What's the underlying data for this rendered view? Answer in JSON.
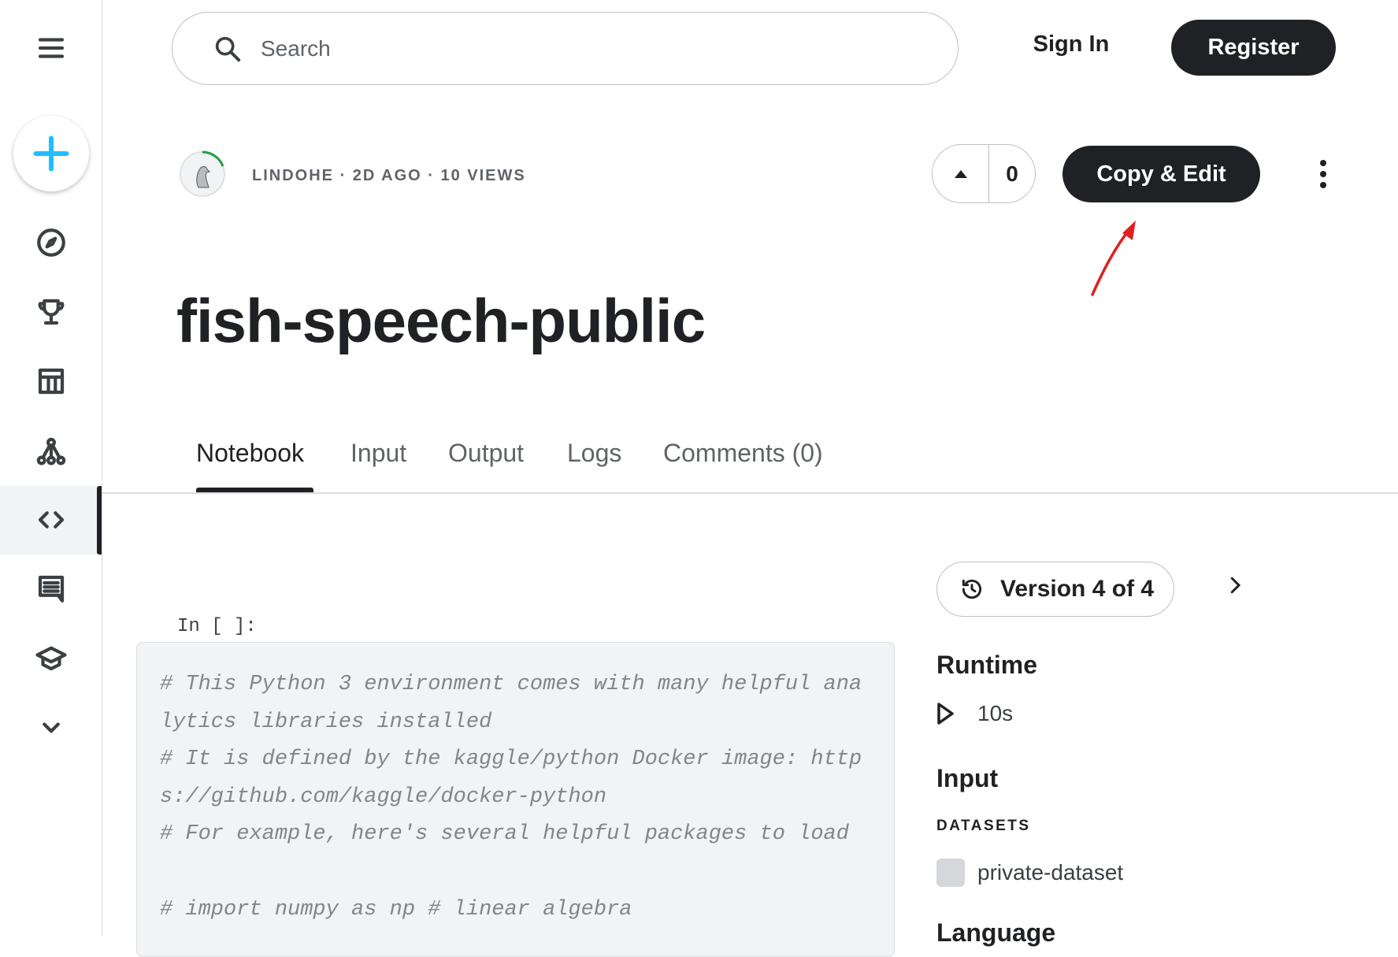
{
  "sidebar": {
    "items": [
      "menu",
      "create",
      "explore",
      "competitions",
      "datasets",
      "models",
      "code",
      "discussions",
      "learn",
      "more"
    ],
    "active": "code"
  },
  "header": {
    "search_placeholder": "Search",
    "sign_in": "Sign In",
    "register": "Register"
  },
  "notebook": {
    "author": "LINDOHE",
    "age": "2D AGO",
    "views": "10 VIEWS",
    "meta_text": "LINDOHE · 2D AGO · 10 VIEWS",
    "votes": "0",
    "copy_edit": "Copy & Edit",
    "title": "fish-speech-public",
    "tabs": [
      "Notebook",
      "Input",
      "Output",
      "Logs",
      "Comments (0)"
    ],
    "prompt": "In [ ]:",
    "code_lines": [
      "# This Python 3 environment comes with many helpful ana",
      "lytics libraries installed",
      "# It is defined by the kaggle/python Docker image: http",
      "s://github.com/kaggle/docker-python",
      "# For example, here's several helpful packages to load",
      "",
      "# import numpy as np # linear algebra"
    ]
  },
  "panel": {
    "version": "Version 4 of 4",
    "runtime_heading": "Runtime",
    "runtime": "10s",
    "input_heading": "Input",
    "datasets_label": "DATASETS",
    "dataset": "private-dataset",
    "language_heading": "Language"
  },
  "colors": {
    "accent": "#20beff",
    "dark": "#202124",
    "annotation": "#e02020"
  }
}
